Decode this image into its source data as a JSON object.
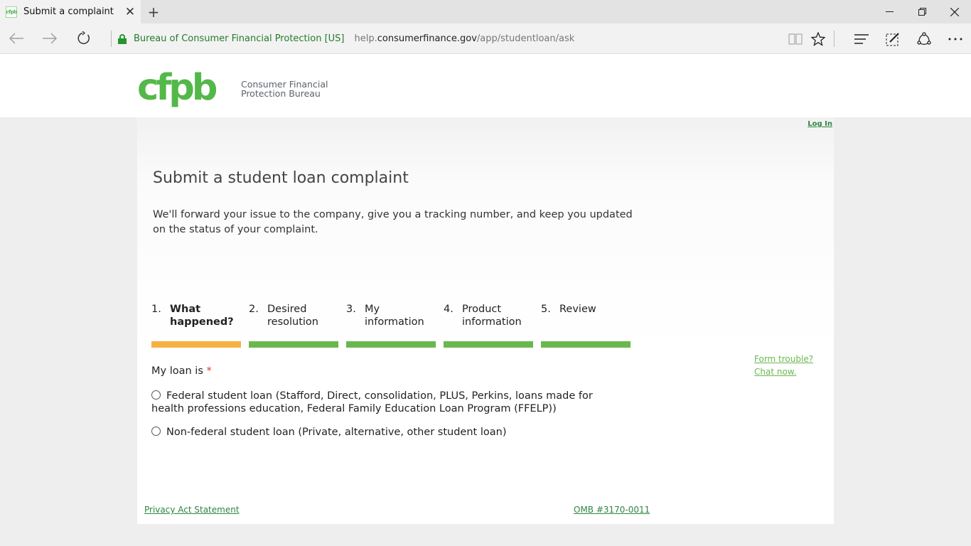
{
  "browser": {
    "tab_title": "Submit a complaint",
    "tab_favicon_text": "cfpb",
    "site_identity": "Bureau of Consumer Financial Protection [US]",
    "url_prefix": "help.",
    "url_domain": "consumerfinance.gov",
    "url_path": "/app/studentloan/ask",
    "accent_color": "#26942c"
  },
  "header": {
    "logo_text": "cfpb",
    "org_line1": "Consumer Financial",
    "org_line2": "Protection Bureau",
    "brand_color": "#53b848"
  },
  "page": {
    "login_label": "Log In",
    "title": "Submit a student loan complaint",
    "intro": "We'll forward your issue to the company, give you a tracking number, and keep you updated on the status of your complaint."
  },
  "steps": [
    {
      "num": "1.",
      "line1": "What",
      "line2": "happened?",
      "active": true
    },
    {
      "num": "2.",
      "line1": "Desired",
      "line2": "resolution",
      "active": false
    },
    {
      "num": "3.",
      "line1": "My",
      "line2": "information",
      "active": false
    },
    {
      "num": "4.",
      "line1": "Product",
      "line2": "information",
      "active": false
    },
    {
      "num": "5.",
      "line1": "Review",
      "line2": "",
      "active": false
    }
  ],
  "form": {
    "loan_label": "My loan is",
    "required_mark": "*",
    "options": [
      {
        "label": "Federal student loan (Stafford, Direct, consolidation, PLUS, Perkins, loans made for health professions education, Federal Family Education Loan Program (FFELP))"
      },
      {
        "label": "Non-federal student loan (Private, alternative, other student loan)"
      }
    ]
  },
  "help": {
    "form_trouble": "Form trouble?",
    "chat_now": "Chat now."
  },
  "footer": {
    "privacy": "Privacy Act Statement",
    "omb": "OMB #3170-0011"
  }
}
